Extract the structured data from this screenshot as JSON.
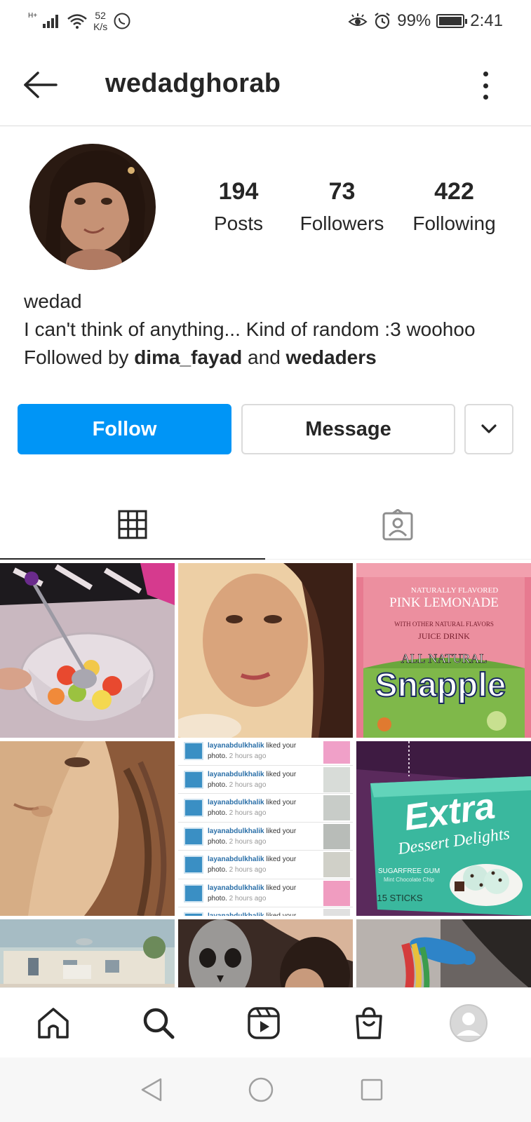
{
  "status_bar": {
    "network": "H+",
    "speed_value": "52",
    "speed_unit": "K/s",
    "battery": "99%",
    "battery_level": 0.99,
    "time": "2:41"
  },
  "header": {
    "username": "wedadghorab"
  },
  "profile": {
    "stats": [
      {
        "value": "194",
        "label": "Posts"
      },
      {
        "value": "73",
        "label": "Followers"
      },
      {
        "value": "422",
        "label": "Following"
      }
    ],
    "name": "wedad",
    "bio": "I can't think of anything... Kind of random :3 woohoo",
    "followed_by_prefix": "Followed by",
    "followed_by_user1": "dima_fayad",
    "followed_by_and": "and",
    "followed_by_user2": "wedaders"
  },
  "actions": {
    "follow_label": "Follow",
    "message_label": "Message"
  },
  "tabs": [
    {
      "name": "grid-icon",
      "active": true
    },
    {
      "name": "tagged-icon",
      "active": false
    }
  ],
  "posts": {
    "snapple": {
      "line1": "NATURALLY FLAVORED",
      "line2": "PINK LEMONADE",
      "line3": "WITH OTHER NATURAL FLAVORS",
      "line4": "JUICE DRINK",
      "line5": "ALL NATURAL",
      "brand": "Snapple"
    },
    "notifications": {
      "user": "layanabdulkhalik",
      "action": "liked your",
      "object": "photo.",
      "time": "2 hours ago"
    },
    "gum": {
      "brand": "Extra",
      "sub": "Dessert Delights",
      "line1": "SUGARFREE GUM",
      "line2": "Mint Chocolate Chip",
      "count": "15 STICKS"
    }
  },
  "colors": {
    "follow_blue": "#0095f6",
    "text": "#262626",
    "border": "#dbdbdb"
  }
}
